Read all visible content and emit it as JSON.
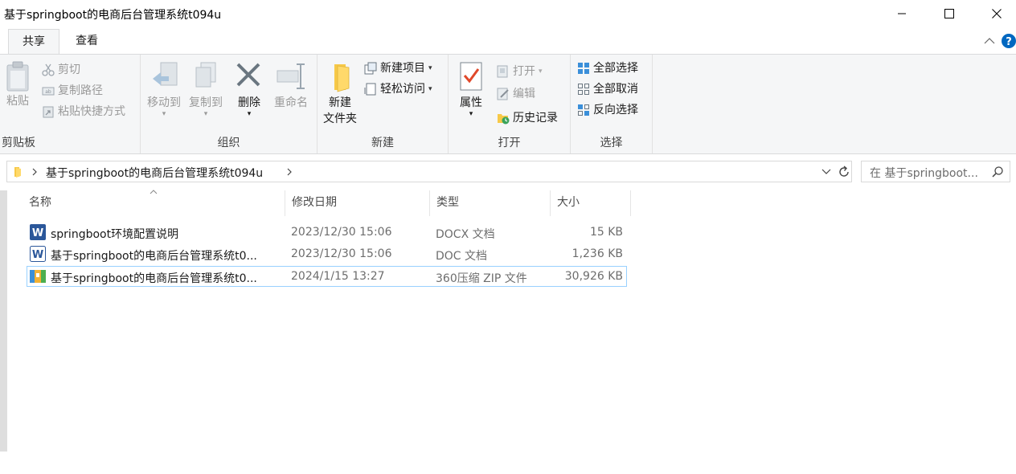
{
  "window": {
    "title": "基于springboot的电商后台管理系统t094u"
  },
  "tabs": [
    {
      "label": "共享"
    },
    {
      "label": "查看"
    }
  ],
  "ribbon": {
    "clipboard": {
      "paste": "粘贴",
      "cut": "剪切",
      "copy_path": "复制路径",
      "paste_shortcut": "粘贴快捷方式",
      "label": "剪贴板"
    },
    "organize": {
      "move_to": "移动到",
      "copy_to": "复制到",
      "delete": "删除",
      "rename": "重命名",
      "label": "组织"
    },
    "new": {
      "new_folder_line1": "新建",
      "new_folder_line2": "文件夹",
      "new_item": "新建项目",
      "easy_access": "轻松访问",
      "label": "新建"
    },
    "open": {
      "properties": "属性",
      "open": "打开",
      "edit": "编辑",
      "history": "历史记录",
      "label": "打开"
    },
    "select": {
      "select_all": "全部选择",
      "select_none": "全部取消",
      "invert": "反向选择",
      "label": "选择"
    }
  },
  "address": {
    "path": "基于springboot的电商后台管理系统t094u"
  },
  "search": {
    "placeholder": "在 基于springboot..."
  },
  "columns": {
    "name": "名称",
    "modified": "修改日期",
    "type": "类型",
    "size": "大小"
  },
  "files": [
    {
      "name": "springboot环境配置说明",
      "modified": "2023/12/30 15:06",
      "type": "DOCX 文档",
      "size": "15 KB",
      "icon": "word-icon"
    },
    {
      "name": "基于springboot的电商后台管理系统t0...",
      "modified": "2023/12/30 15:06",
      "type": "DOC 文档",
      "size": "1,236 KB",
      "icon": "word-doc-icon"
    },
    {
      "name": "基于springboot的电商后台管理系统t0...",
      "modified": "2024/1/15 13:27",
      "type": "360压缩 ZIP 文件",
      "size": "30,926 KB",
      "icon": "zip-icon",
      "selected": true
    }
  ],
  "colors": {
    "accent": "#0067c0",
    "selection_border": "#99d1ff",
    "ribbon_bg": "#f5f6f7"
  }
}
